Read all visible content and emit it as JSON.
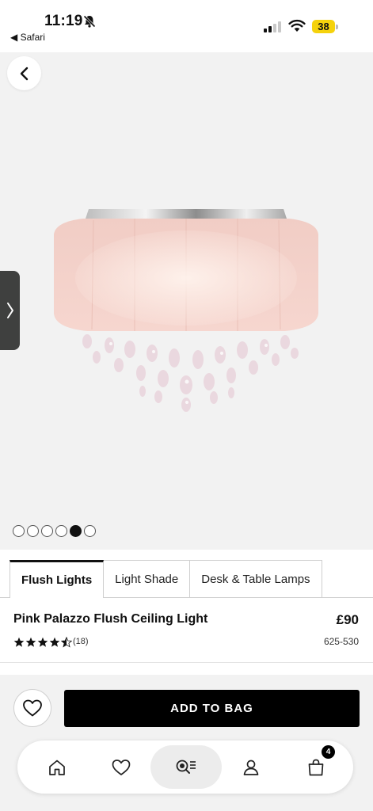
{
  "status_bar": {
    "time": "11:19",
    "back_app": "◀ Safari",
    "battery": "38",
    "battery_color": "#f5d20c"
  },
  "gallery": {
    "image_alt": "Pink Palazzo flush ceiling light with crystal droplets",
    "dot_count": 6,
    "active_dot": 5
  },
  "tabs": [
    {
      "label": "Flush Lights",
      "active": true
    },
    {
      "label": "Light Shade",
      "active": false
    },
    {
      "label": "Desk & Table Lamps",
      "active": false
    }
  ],
  "product": {
    "title": "Pink Palazzo Flush Ceiling Light",
    "price": "£90",
    "rating": 4.5,
    "reviews": "(18)",
    "sku": "625-530"
  },
  "actions": {
    "add_to_bag": "ADD TO BAG"
  },
  "nav": {
    "items": [
      "home-icon",
      "heart-icon",
      "visual-search-icon",
      "account-icon",
      "bag-icon"
    ],
    "active": "visual-search-icon",
    "bag_count": "4"
  },
  "colors": {
    "accent": "#000000",
    "shade_pink": "#f3cfc8",
    "background": "#f2f2f2"
  }
}
